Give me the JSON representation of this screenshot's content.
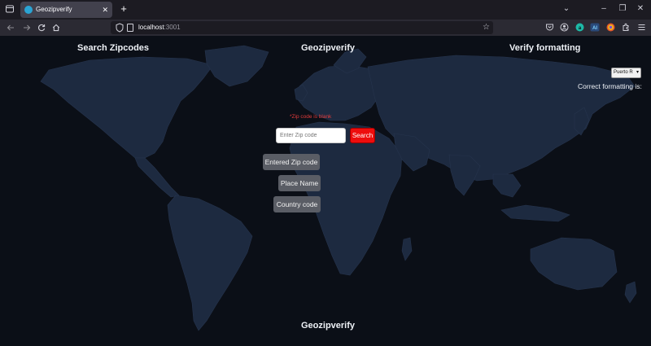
{
  "browser": {
    "tab": {
      "title": "Geozipverify",
      "close_glyph": "✕"
    },
    "new_tab_glyph": "+",
    "address": {
      "host": "localhost",
      "port": ":3001"
    },
    "window_controls": {
      "tabs_list": "⌄",
      "minimize": "–",
      "restore": "❐",
      "close": "✕"
    }
  },
  "header": {
    "search_link": "Search Zipcodes",
    "brand": "Geozipverify",
    "verify_link": "Verify formatting"
  },
  "verify": {
    "country_selected": "Puerto R",
    "correct_formatting_label": "Correct formatting is:"
  },
  "search": {
    "error_text": "*Zip code is blank",
    "placeholder": "Enter Zip code",
    "button_label": "Search"
  },
  "results": {
    "entered_zip_label": "Entered Zip code",
    "place_name_label": "Place Name",
    "country_code_label": "Country code"
  },
  "footer": {
    "brand": "Geozipverify"
  },
  "colors": {
    "page_background": "#0b0f17",
    "land": "#1d2a40",
    "search_button": "#ee0d0d",
    "error_text": "#e23b3b",
    "result_pill": "#5a5d65"
  }
}
